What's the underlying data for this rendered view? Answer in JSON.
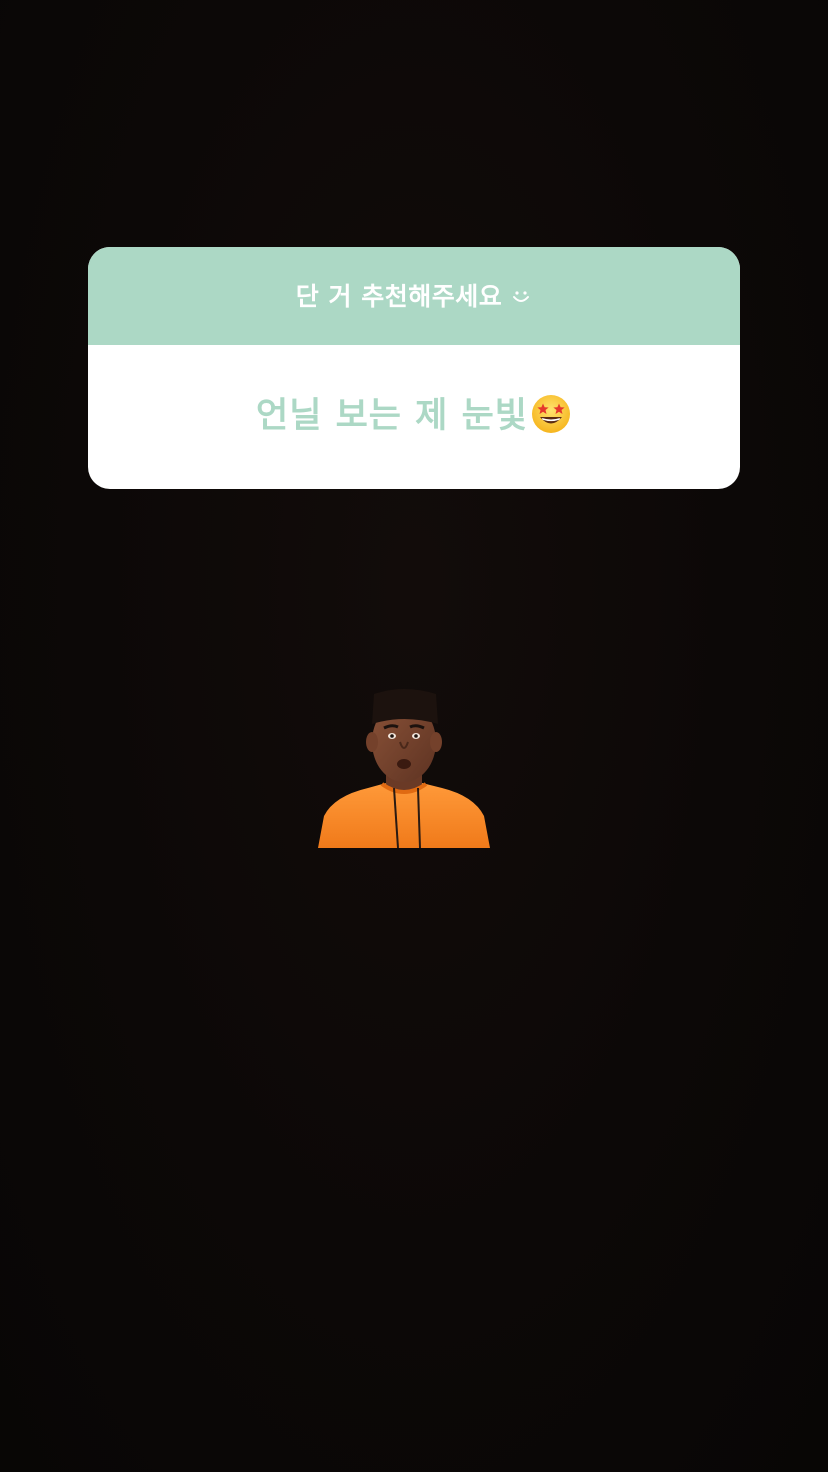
{
  "question_sticker": {
    "question": "단 거 추천해주세요",
    "question_icon": "smile-icon",
    "answer": "언닐 보는 제 눈빛",
    "answer_icon": "star-struck-emoji",
    "header_color": "#acd8c5",
    "answer_color": "#acd8c5"
  },
  "gif_sticker": {
    "icon": "surprised-man-orange-shirt-sticker"
  },
  "background_color": "#0b0807"
}
